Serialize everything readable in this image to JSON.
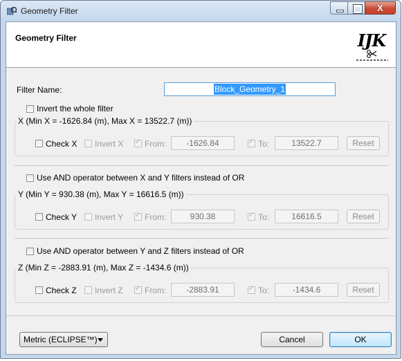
{
  "window": {
    "title": "Geometry Filter",
    "min_icon": "minimize-icon",
    "max_icon": "maximize-icon",
    "close_glyph": "X"
  },
  "header": {
    "title": "Geometry Filter",
    "logo_text": "IJK",
    "logo_icon": "scissors-cut-line-icon"
  },
  "filter_name": {
    "label": "Filter Name:",
    "value": "Block_Geometry_1"
  },
  "invert_whole": {
    "label": "Invert the whole filter",
    "checked": false
  },
  "x_group": {
    "title": "X (Min X = -1626.84 (m), Max X = 13522.7 (m))",
    "check_label": "Check X",
    "invert_label": "Invert X",
    "from_label": "From:",
    "from_value": "-1626.84",
    "to_label": "To:",
    "to_value": "13522.7",
    "reset_label": "Reset"
  },
  "and_xy": {
    "label": "Use AND operator between X and Y filters instead of OR",
    "checked": false
  },
  "y_group": {
    "title": "Y (Min Y = 930.38 (m), Max Y = 16616.5 (m))",
    "check_label": "Check Y",
    "invert_label": "Invert Y",
    "from_label": "From:",
    "from_value": "930.38",
    "to_label": "To:",
    "to_value": "16616.5",
    "reset_label": "Reset"
  },
  "and_yz": {
    "label": "Use AND operator between Y and Z filters instead of OR",
    "checked": false
  },
  "z_group": {
    "title": "Z (Min Z = -2883.91 (m), Max Z = -1434.6 (m))",
    "check_label": "Check Z",
    "invert_label": "Invert Z",
    "from_label": "From:",
    "from_value": "-2883.91",
    "to_label": "To:",
    "to_value": "-1434.6",
    "reset_label": "Reset"
  },
  "footer": {
    "units_selected": "Metric (ECLIPSE™)",
    "cancel_label": "Cancel",
    "ok_label": "OK"
  },
  "colors": {
    "accent": "#3399ff",
    "titlebar": "#c2d6ec",
    "close": "#c94a35"
  }
}
